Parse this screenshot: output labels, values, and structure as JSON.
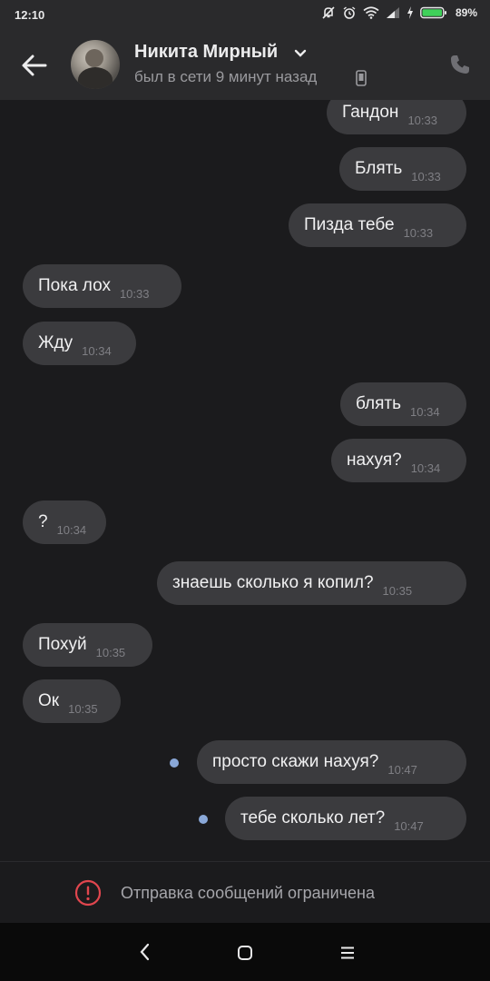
{
  "status_bar": {
    "time": "12:10",
    "battery": "89%"
  },
  "header": {
    "contact_name": "Никита Мирный",
    "contact_status": "был в сети 9 минут назад"
  },
  "messages": [
    {
      "side": "out",
      "text": "Гандон",
      "time": "10:33"
    },
    {
      "side": "out",
      "text": "Блять",
      "time": "10:33"
    },
    {
      "side": "out",
      "text": "Пизда тебе",
      "time": "10:33"
    },
    {
      "side": "in",
      "text": "Пока лох",
      "time": "10:33"
    },
    {
      "side": "in",
      "text": "Жду",
      "time": "10:34"
    },
    {
      "side": "out",
      "text": "блять",
      "time": "10:34"
    },
    {
      "side": "out",
      "text": "нахуя?",
      "time": "10:34"
    },
    {
      "side": "in",
      "text": "?",
      "time": "10:34"
    },
    {
      "side": "out",
      "text": "знаешь сколько я копил?",
      "time": "10:35"
    },
    {
      "side": "in",
      "text": "Похуй",
      "time": "10:35"
    },
    {
      "side": "in",
      "text": "Ок",
      "time": "10:35"
    },
    {
      "side": "out",
      "text": "просто скажи нахуя?",
      "time": "10:47",
      "unread": true
    },
    {
      "side": "out",
      "text": "тебе сколько лет?",
      "time": "10:47",
      "unread": true
    }
  ],
  "restriction": {
    "text": "Отправка сообщений ограничена",
    "color": "#e0464e"
  },
  "colors": {
    "background": "#1b1b1d",
    "header": "#2a2a2c",
    "bubble": "#3b3b3e",
    "unread_dot": "#8aa8d8"
  }
}
